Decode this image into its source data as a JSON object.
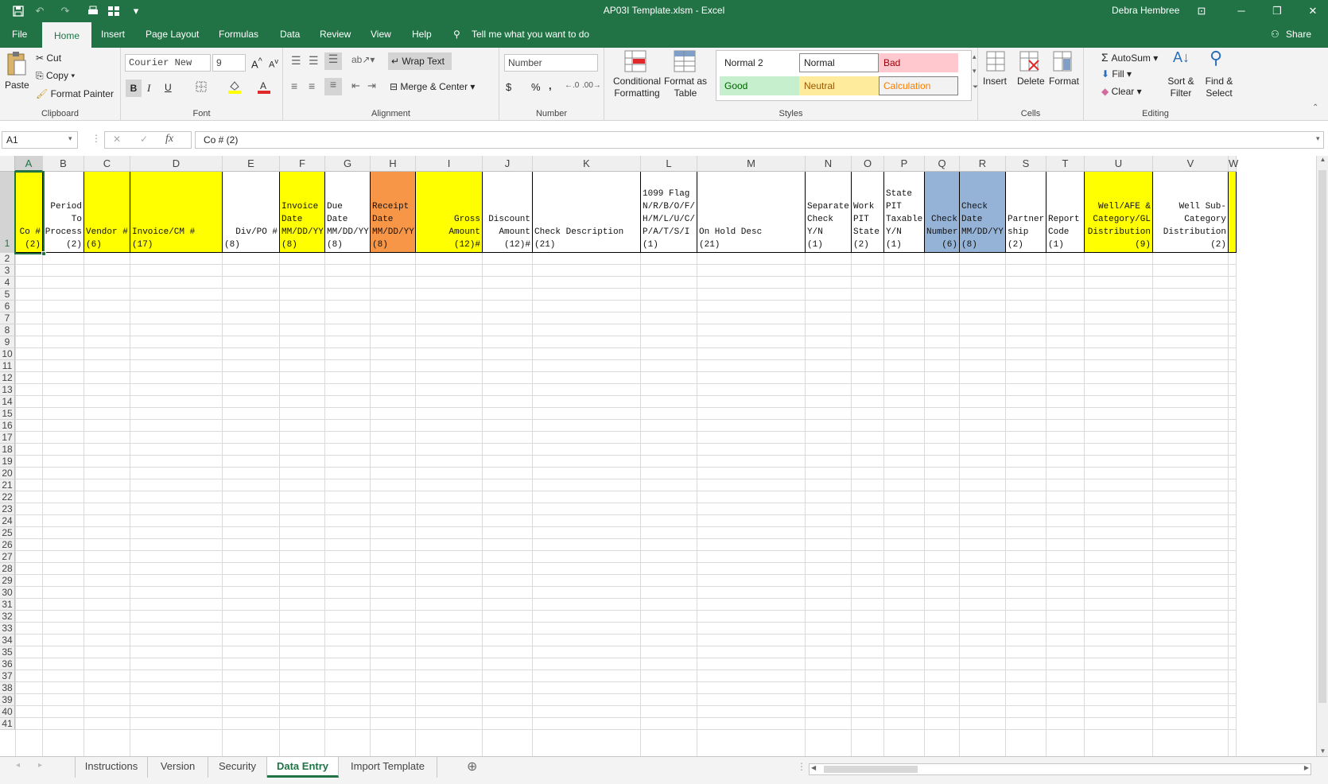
{
  "window": {
    "title": "AP03I Template.xlsm  -  Excel",
    "user": "Debra Hembree",
    "controls": {
      "minimize": "─",
      "restore": "❐",
      "close": "✕",
      "ribbon_display": "⊡"
    }
  },
  "quick_access": {
    "save": "💾",
    "undo": "↶",
    "redo": "↷",
    "customize": "▾"
  },
  "menu": {
    "tabs": [
      "File",
      "Home",
      "Insert",
      "Page Layout",
      "Formulas",
      "Data",
      "Review",
      "View",
      "Help"
    ],
    "active": "Home",
    "tell_me": "Tell me what you want to do",
    "share": "Share"
  },
  "ribbon": {
    "clipboard": {
      "label": "Clipboard",
      "paste": "Paste",
      "cut": "Cut",
      "copy": "Copy",
      "format_painter": "Format Painter"
    },
    "font": {
      "label": "Font",
      "family": "Courier New",
      "size": "9",
      "bold": "B",
      "italic": "I",
      "underline": "U"
    },
    "alignment": {
      "label": "Alignment",
      "wrap_text": "Wrap Text",
      "merge_center": "Merge & Center"
    },
    "number": {
      "label": "Number",
      "format": "Number",
      "currency": "$",
      "percent": "%",
      "comma": ","
    },
    "styles": {
      "label": "Styles",
      "conditional": "Conditional Formatting",
      "format_table": "Format as Table",
      "gallery": [
        {
          "name": "Normal 2",
          "bg": "#ffffff",
          "fg": "#222222",
          "border": "#ffffff"
        },
        {
          "name": "Normal",
          "bg": "#ffffff",
          "fg": "#222222",
          "border": "#8a8a8a"
        },
        {
          "name": "Bad",
          "bg": "#ffc7ce",
          "fg": "#9c0006",
          "border": "#ffc7ce"
        },
        {
          "name": "Good",
          "bg": "#c6efce",
          "fg": "#006100",
          "border": "#c6efce"
        },
        {
          "name": "Neutral",
          "bg": "#ffeb9c",
          "fg": "#9c5700",
          "border": "#ffeb9c"
        },
        {
          "name": "Calculation",
          "bg": "#f2f2f2",
          "fg": "#fa7d00",
          "border": "#7f7f7f"
        }
      ]
    },
    "cells": {
      "label": "Cells",
      "insert": "Insert",
      "delete": "Delete",
      "format": "Format"
    },
    "editing": {
      "label": "Editing",
      "autosum": "AutoSum",
      "fill": "Fill",
      "clear": "Clear",
      "sort_filter": "Sort & Filter",
      "find_select": "Find & Select"
    }
  },
  "formula_bar": {
    "name_box": "A1",
    "formula": "Co #  (2)",
    "fx": "fx"
  },
  "sheet": {
    "columns": [
      {
        "letter": "A",
        "w": 35,
        "bg": "#ffff00",
        "text": "Co #",
        "width": "(2)",
        "align": "right",
        "selected": true
      },
      {
        "letter": "B",
        "w": 52,
        "bg": "#ffffff",
        "text": "Period\nTo\nProcess",
        "width": "(2)",
        "align": "right"
      },
      {
        "letter": "C",
        "w": 58,
        "bg": "#ffff00",
        "text": "Vendor #",
        "width": "(6)",
        "align": "left"
      },
      {
        "letter": "D",
        "w": 116,
        "bg": "#ffff00",
        "text": "Invoice/CM #",
        "width": "(17)",
        "align": "left"
      },
      {
        "letter": "E",
        "w": 72,
        "bg": "#ffffff",
        "text": "Div/PO #",
        "width": "(8)",
        "align": "right",
        "wleft": true
      },
      {
        "letter": "F",
        "w": 57,
        "bg": "#ffff00",
        "text": "Invoice\nDate\nMM/DD/YY",
        "width": "(8)",
        "align": "left"
      },
      {
        "letter": "G",
        "w": 57,
        "bg": "#ffffff",
        "text": "Due Date\nMM/DD/YY",
        "width": "(8)",
        "align": "left"
      },
      {
        "letter": "H",
        "w": 57,
        "bg": "#f79646",
        "text": "Receipt\nDate\nMM/DD/YY",
        "width": "(8)",
        "align": "left"
      },
      {
        "letter": "I",
        "w": 84,
        "bg": "#ffff00",
        "text": "Gross Amount",
        "width": "(12)#",
        "align": "right"
      },
      {
        "letter": "J",
        "w": 63,
        "bg": "#ffffff",
        "text": "Discount\nAmount",
        "width": "(12)#",
        "align": "right"
      },
      {
        "letter": "K",
        "w": 136,
        "bg": "#ffffff",
        "text": "Check Description",
        "width": "(21)",
        "align": "left"
      },
      {
        "letter": "L",
        "w": 71,
        "bg": "#ffffff",
        "text": "1099 Flag\nN/R/B/O/F/\nH/M/L/U/C/\nP/A/T/S/I",
        "width": "(1)",
        "align": "left"
      },
      {
        "letter": "M",
        "w": 136,
        "bg": "#ffffff",
        "text": "On Hold Desc",
        "width": "(21)",
        "align": "left"
      },
      {
        "letter": "N",
        "w": 58,
        "bg": "#ffffff",
        "text": "Separate\nCheck\nY/N",
        "width": "(1)",
        "align": "left"
      },
      {
        "letter": "O",
        "w": 41,
        "bg": "#ffffff",
        "text": "Work\nPIT\nState",
        "width": "(2)",
        "align": "left"
      },
      {
        "letter": "P",
        "w": 51,
        "bg": "#ffffff",
        "text": "State\nPIT\nTaxable\nY/N",
        "width": "(1)",
        "align": "left"
      },
      {
        "letter": "Q",
        "w": 44,
        "bg": "#95b3d7",
        "text": "Check\nNumber",
        "width": "(6)",
        "align": "right"
      },
      {
        "letter": "R",
        "w": 58,
        "bg": "#95b3d7",
        "text": "Check\nDate\nMM/DD/YY",
        "width": "(8)",
        "align": "left"
      },
      {
        "letter": "S",
        "w": 51,
        "bg": "#ffffff",
        "text": "Partner\nship",
        "width": "(2)",
        "align": "left"
      },
      {
        "letter": "T",
        "w": 48,
        "bg": "#ffffff",
        "text": "Report\nCode",
        "width": "(1)",
        "align": "left"
      },
      {
        "letter": "U",
        "w": 86,
        "bg": "#ffff00",
        "text": "Well/AFE &\nCategory/GL\nDistribution",
        "width": "(9)",
        "align": "right"
      },
      {
        "letter": "V",
        "w": 95,
        "bg": "#ffffff",
        "text": "Well Sub-\nCategory\nDistribution",
        "width": "(2)",
        "align": "right"
      },
      {
        "letter": "W",
        "w": 10,
        "bg": "#ffff00",
        "text": "",
        "width": "",
        "align": "left"
      }
    ],
    "rows": [
      "1",
      "2",
      "3",
      "4",
      "5",
      "6",
      "7",
      "8",
      "9",
      "10",
      "11",
      "12",
      "13",
      "14",
      "15",
      "16",
      "17",
      "18",
      "19",
      "20",
      "21",
      "22",
      "23",
      "24",
      "25",
      "26",
      "27",
      "28",
      "29",
      "30",
      "31",
      "32",
      "33",
      "34",
      "35",
      "36",
      "37",
      "38",
      "39",
      "40",
      "41"
    ]
  },
  "sheet_tabs": {
    "tabs": [
      "Instructions",
      "Version",
      "Security",
      "Data Entry",
      "Import Template"
    ],
    "active": "Data Entry",
    "add": "⊕"
  }
}
